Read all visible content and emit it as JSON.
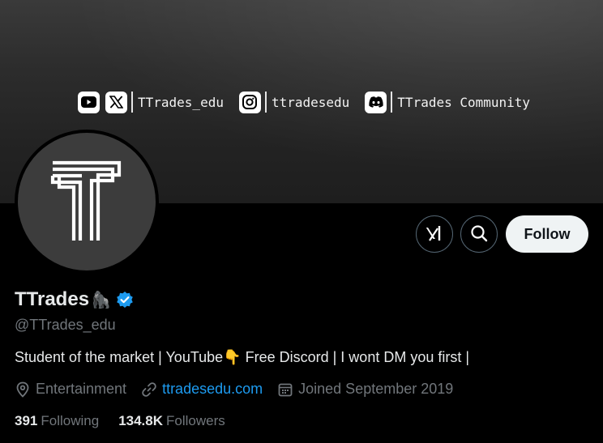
{
  "banner": {
    "youtube_icon": "youtube-icon",
    "x_icon": "x-icon",
    "x_handle": "TTrades_edu",
    "instagram_icon": "instagram-icon",
    "instagram_handle": "ttradesedu",
    "discord_icon": "discord-icon",
    "discord_label": "TTrades Community"
  },
  "profile": {
    "display_name": "TTrades",
    "name_emoji": "🦍",
    "handle": "@TTrades_edu",
    "bio": "Student of the market | YouTube👇 Free Discord | I wont DM you first |",
    "category": "Entertainment",
    "website": "ttradesedu.com",
    "joined": "Joined September 2019",
    "following_count": "391",
    "following_label": "Following",
    "followers_count": "134.8K",
    "followers_label": "Followers"
  },
  "actions": {
    "grok_icon": "grok-icon",
    "search_icon": "search-icon",
    "follow_label": "Follow"
  },
  "colors": {
    "accent": "#1d9bf0",
    "muted": "#71767b",
    "background": "#000000",
    "follow_button_bg": "#eff3f4"
  }
}
